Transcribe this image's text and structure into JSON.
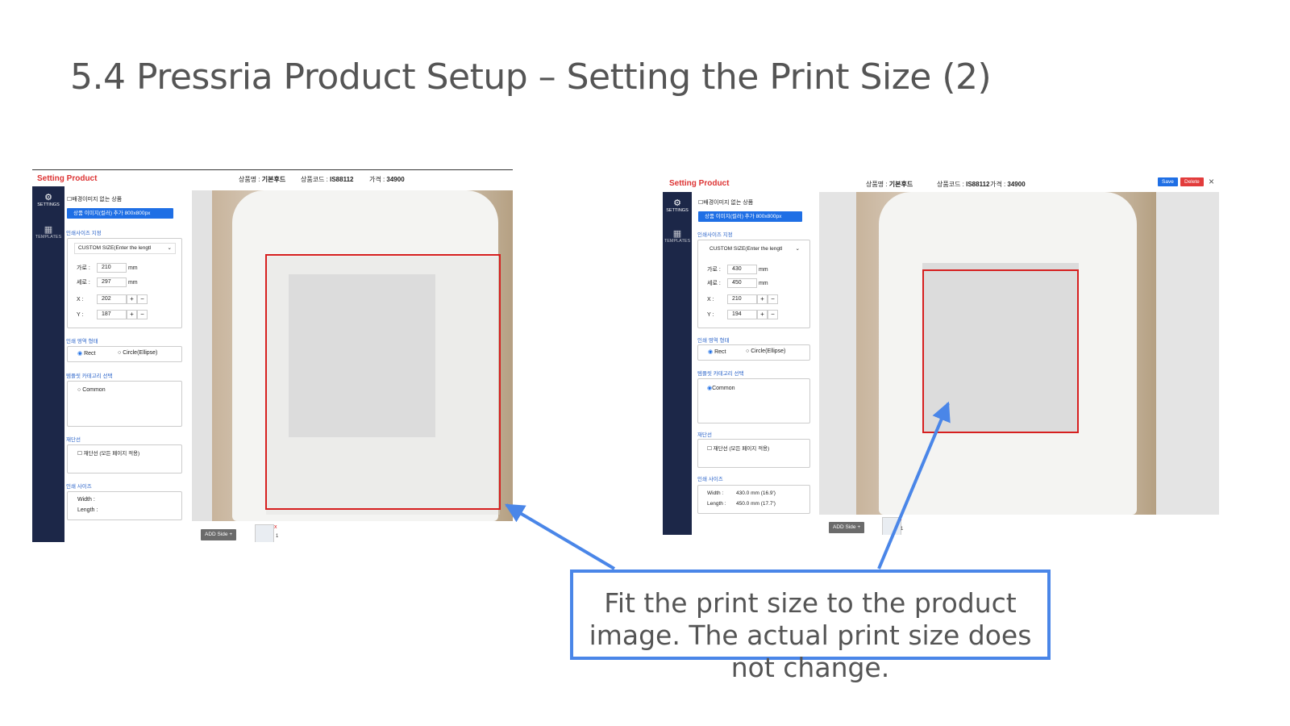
{
  "slide": {
    "title": "5.4 Pressria Product Setup – Setting the Print Size (2)",
    "callout_text": "Fit the print size to the product image. The actual print size does not change."
  },
  "app": {
    "title": "Setting Product",
    "product_name_label": "상품명 :",
    "product_name": "기본후드",
    "product_code_label": "상품코드 :",
    "product_code": "IS88112",
    "price_label": "가격 :",
    "price": "34900",
    "save_label": "Save",
    "delete_label": "Delete",
    "close_icon": "close-icon",
    "nav": [
      {
        "label": "SETTINGS",
        "icon": "gear-icon"
      },
      {
        "label": "TEMPLATES",
        "icon": "grid-icon"
      }
    ],
    "no_bg_checkbox": "배경이미지 없는 상품",
    "add_image_button": "상품 이미지(컬러) 추가 800x800px",
    "print_size_section": "인쇄사이즈 지정",
    "size_select": "CUSTOM SIZE(Enter the lengtl",
    "width_label": "가로 :",
    "height_label": "세로 :",
    "x_label": "X :",
    "y_label": "Y :",
    "unit": "mm",
    "area_shape_section": "인쇄 영역 형태",
    "shape_rect": "Rect",
    "shape_circle": "Circle(Ellipse)",
    "template_category_section": "템플릿 카테고리 선택",
    "category_common": "Common",
    "cut_line_section": "재단선",
    "cut_line_checkbox": "재단선 (모든 페이지 적용)",
    "print_size_info_section": "인쇄 사이즈",
    "width_info_label": "Width :",
    "length_info_label": "Length :",
    "add_side_button": "ADD Side +",
    "thumb_remove": "x",
    "thumb_number": "1"
  },
  "left_screen": {
    "width_value": "210",
    "height_value": "297",
    "x_value": "202",
    "y_value": "187",
    "width_info": "",
    "length_info": ""
  },
  "right_screen": {
    "width_value": "430",
    "height_value": "450",
    "x_value": "210",
    "y_value": "194",
    "width_info": "430.0 mm (16.9')",
    "length_info": "450.0 mm (17.7')"
  }
}
